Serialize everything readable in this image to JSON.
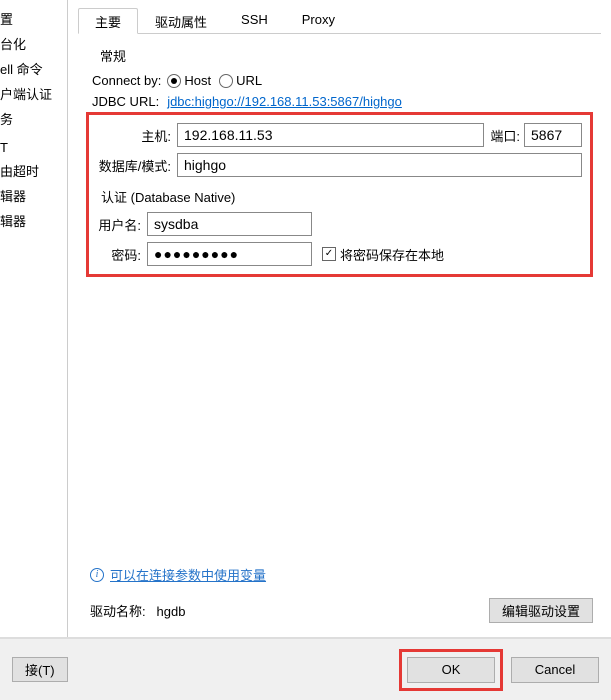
{
  "sidebar": {
    "items": [
      {
        "label": "置"
      },
      {
        "label": "台化"
      },
      {
        "label": "ell 命令"
      },
      {
        "label": "户端认证"
      },
      {
        "label": "务"
      },
      {
        "label": ""
      },
      {
        "label": "T"
      },
      {
        "label": "由超时"
      },
      {
        "label": "辑器"
      },
      {
        "label": "辑器"
      }
    ]
  },
  "tabs": [
    {
      "label": "主要",
      "active": true
    },
    {
      "label": "驱动属性",
      "active": false
    },
    {
      "label": "SSH",
      "active": false
    },
    {
      "label": "Proxy",
      "active": false
    }
  ],
  "general": {
    "title": "常规",
    "connect_by_label": "Connect by:",
    "radio_host": "Host",
    "radio_url": "URL",
    "connect_by_value": "host",
    "jdbc_label": "JDBC URL:",
    "jdbc_url": "jdbc:highgo://192.168.11.53:5867/highgo"
  },
  "conn": {
    "host_label": "主机:",
    "host_value": "192.168.11.53",
    "port_label": "端口:",
    "port_value": "5867",
    "db_label": "数据库/模式:",
    "db_value": "highgo"
  },
  "auth": {
    "title": "认证 (Database Native)",
    "user_label": "用户名:",
    "user_value": "sysdba",
    "pw_label": "密码:",
    "pw_value": "●●●●●●●●●",
    "save_pw_label": "将密码保存在本地",
    "save_pw_checked": true
  },
  "info_link": "可以在连接参数中使用变量",
  "driver": {
    "label": "驱动名称:",
    "name": "hgdb",
    "edit_button": "编辑驱动设置"
  },
  "footer": {
    "test_button": "接(T)",
    "ok": "OK",
    "cancel": "Cancel"
  }
}
